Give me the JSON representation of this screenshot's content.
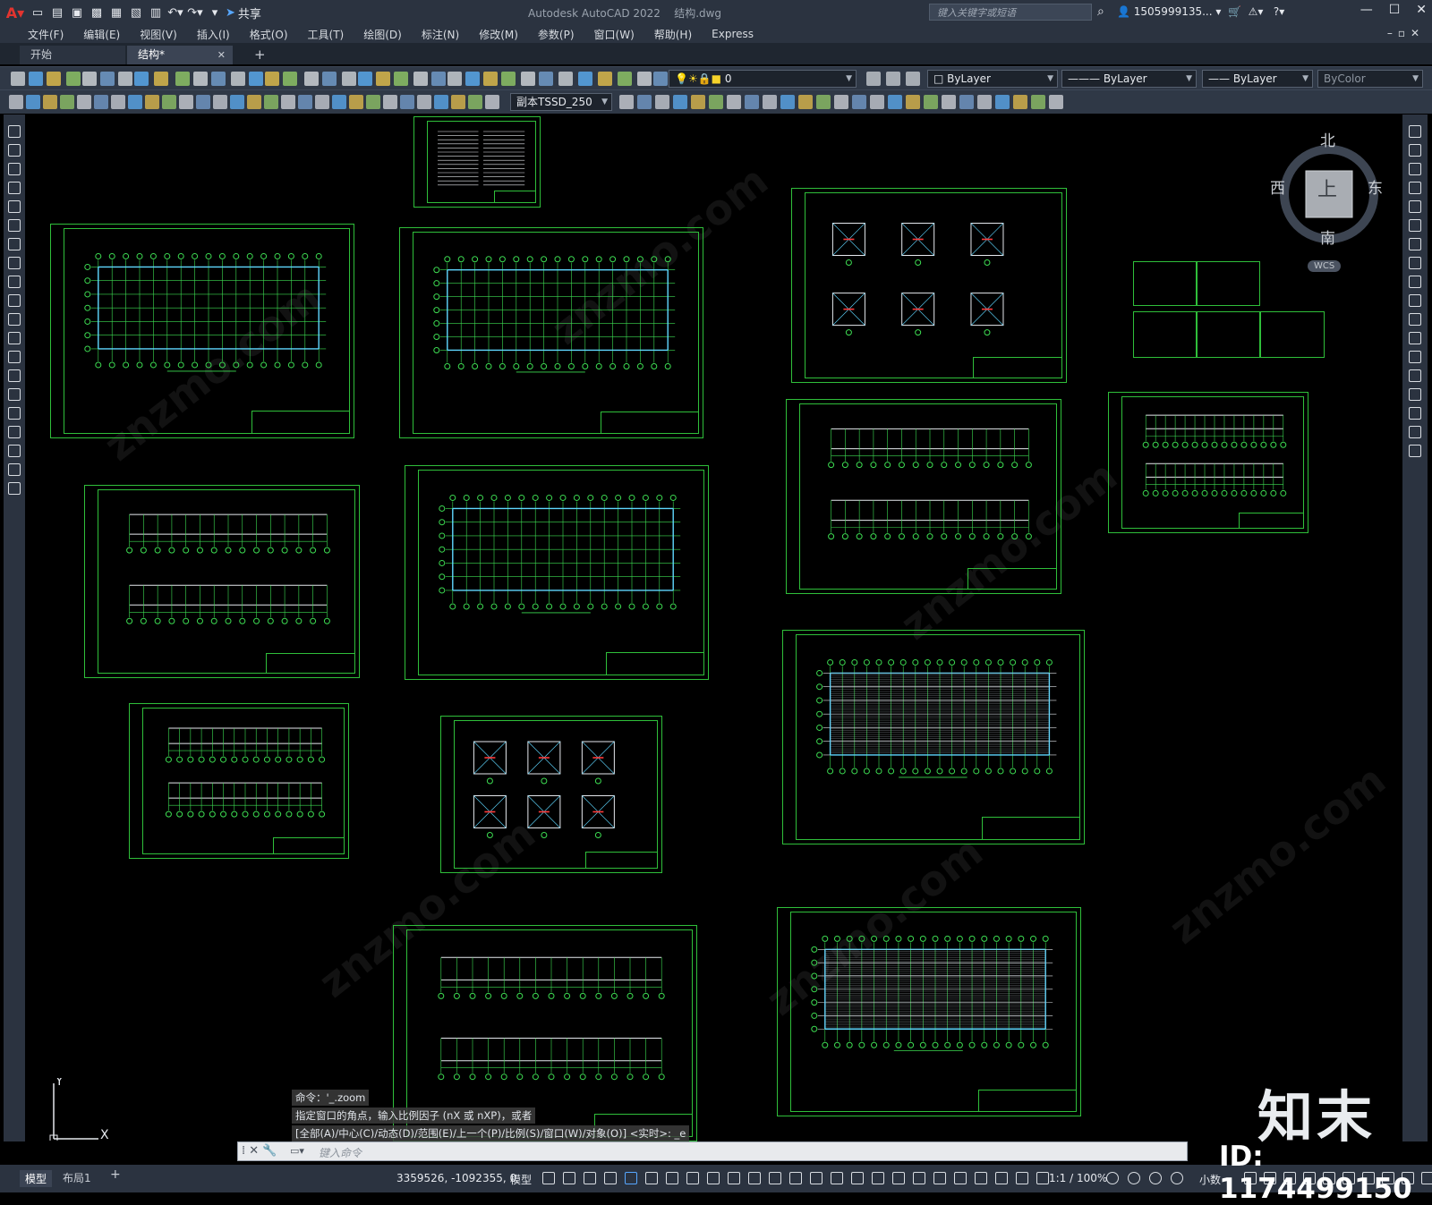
{
  "app": {
    "title": "Autodesk AutoCAD 2022",
    "filename": "结构.dwg",
    "search_placeholder": "键入关键字或短语",
    "user": "1505999135...",
    "share_label": "共享"
  },
  "menu": [
    "文件(F)",
    "编辑(E)",
    "视图(V)",
    "插入(I)",
    "格式(O)",
    "工具(T)",
    "绘图(D)",
    "标注(N)",
    "修改(M)",
    "参数(P)",
    "窗口(W)",
    "帮助(H)",
    "Express"
  ],
  "tabs": [
    {
      "label": "开始"
    },
    {
      "label": "结构*"
    }
  ],
  "toolbar": {
    "layer_value": "0",
    "textstyle_value": "副本TSSD_250",
    "color_value": "ByLayer",
    "linetype_value": "ByLayer",
    "lineweight_value": "ByLayer",
    "plotstyle_value": "ByColor"
  },
  "viewcube": {
    "north": "北",
    "south": "南",
    "east": "东",
    "west": "西",
    "face": "上",
    "wcs": "WCS"
  },
  "command": {
    "history": [
      "命令：'_.zoom",
      "指定窗口的角点，输入比例因子 (nX 或 nXP)，或者",
      "[全部(A)/中心(C)/动态(D)/范围(E)/上一个(P)/比例(S)/窗口(W)/对象(O)] <实时>: _e"
    ],
    "input_placeholder": "键入命令"
  },
  "status": {
    "layout_tabs": [
      "模型",
      "布局1"
    ],
    "coords": "3359526, -1092355, 0",
    "model": "模型",
    "scale": "1:1 / 100%",
    "units": "小数"
  },
  "watermark": {
    "brand": "知末",
    "id": "ID: 1174499150"
  }
}
